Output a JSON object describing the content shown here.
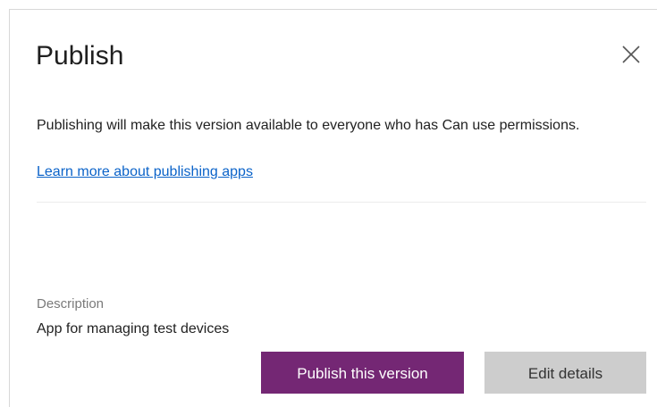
{
  "dialog": {
    "title": "Publish",
    "close_icon": "close-icon",
    "message": "Publishing will make this version available to everyone who has Can use permissions.",
    "learn_more_link": "Learn more about publishing apps",
    "description_label": "Description",
    "description_value": "App for managing test devices",
    "primary_button": "Publish this version",
    "secondary_button": "Edit details"
  },
  "colors": {
    "primary_button_bg": "#742774",
    "secondary_button_bg": "#cdcdcd",
    "link": "#0b63c9"
  }
}
